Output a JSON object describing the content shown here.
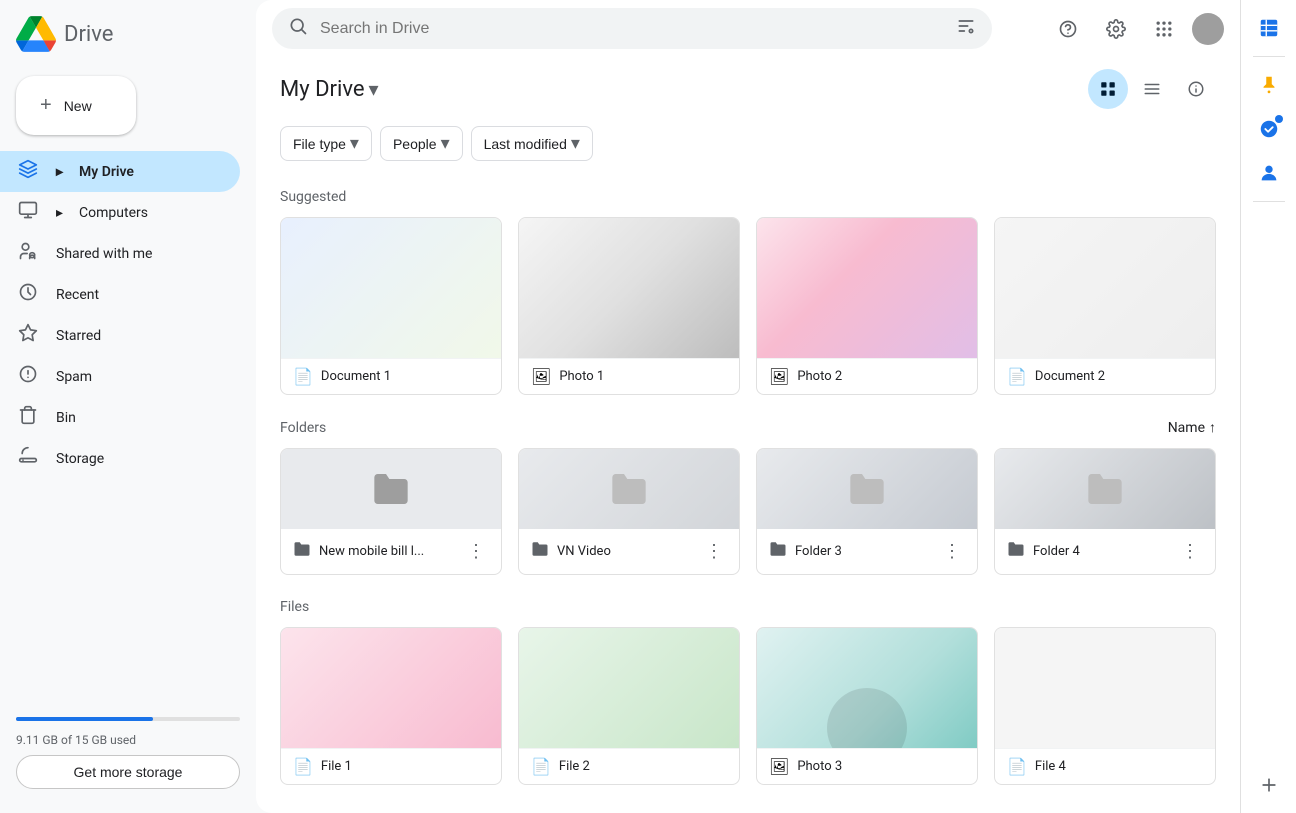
{
  "app": {
    "title": "Drive",
    "search_placeholder": "Search in Drive"
  },
  "sidebar": {
    "new_button_label": "New",
    "nav_items": [
      {
        "id": "my-drive",
        "label": "My Drive",
        "icon": "🖥",
        "active": true,
        "has_arrow": true
      },
      {
        "id": "computers",
        "label": "Computers",
        "icon": "💻",
        "active": false,
        "has_arrow": true
      },
      {
        "id": "shared",
        "label": "Shared with me",
        "icon": "👥",
        "active": false
      },
      {
        "id": "recent",
        "label": "Recent",
        "icon": "🕐",
        "active": false
      },
      {
        "id": "starred",
        "label": "Starred",
        "icon": "⭐",
        "active": false
      },
      {
        "id": "spam",
        "label": "Spam",
        "icon": "⚠",
        "active": false
      },
      {
        "id": "bin",
        "label": "Bin",
        "icon": "🗑",
        "active": false
      },
      {
        "id": "storage",
        "label": "Storage",
        "icon": "☁",
        "active": false
      }
    ],
    "storage": {
      "used_text": "9.11 GB of 15 GB used",
      "used_pct": 61,
      "btn_label": "Get more storage"
    }
  },
  "header": {
    "drive_title": "My Drive",
    "filters": [
      {
        "id": "file-type",
        "label": "File type"
      },
      {
        "id": "people",
        "label": "People"
      },
      {
        "id": "last-modified",
        "label": "Last modified"
      }
    ]
  },
  "suggested": {
    "section_label": "Suggested",
    "items": [
      {
        "id": 1,
        "name": "Document 1",
        "thumb_class": "card-thumb-1"
      },
      {
        "id": 2,
        "name": "Photo 1",
        "thumb_class": "card-thumb-2"
      },
      {
        "id": 3,
        "name": "Photo 2",
        "thumb_class": "card-thumb-3"
      },
      {
        "id": 4,
        "name": "Document 2",
        "thumb_class": "card-thumb-4"
      }
    ]
  },
  "folders": {
    "section_label": "Folders",
    "sort_label": "Name",
    "items": [
      {
        "id": 1,
        "name": "New mobile bill l...",
        "thumb_class": "folder-thumb"
      },
      {
        "id": 2,
        "name": "VN Video",
        "thumb_class": "folder-thumb-2"
      },
      {
        "id": 3,
        "name": "Folder 3",
        "thumb_class": "folder-thumb-3"
      },
      {
        "id": 4,
        "name": "Folder 4",
        "thumb_class": "folder-thumb-4"
      }
    ]
  },
  "files": {
    "section_label": "Files",
    "items": [
      {
        "id": 1,
        "name": "File 1",
        "thumb_class": "file-thumb-1"
      },
      {
        "id": 2,
        "name": "File 2",
        "thumb_class": "file-thumb-2"
      },
      {
        "id": 3,
        "name": "Photo 3",
        "thumb_class": "file-thumb-3"
      },
      {
        "id": 4,
        "name": "File 4",
        "thumb_class": "file-thumb-4"
      }
    ]
  },
  "right_sidebar": {
    "icons": [
      {
        "id": "sheets",
        "symbol": "📊",
        "has_badge": false
      },
      {
        "id": "keep",
        "symbol": "💛",
        "has_badge": false
      },
      {
        "id": "tasks",
        "symbol": "✅",
        "has_badge": true
      },
      {
        "id": "contacts",
        "symbol": "👤",
        "has_badge": false
      }
    ]
  },
  "colors": {
    "accent": "#1a73e8",
    "active_bg": "#c2e7ff",
    "sidebar_bg": "#f8f9fa"
  }
}
